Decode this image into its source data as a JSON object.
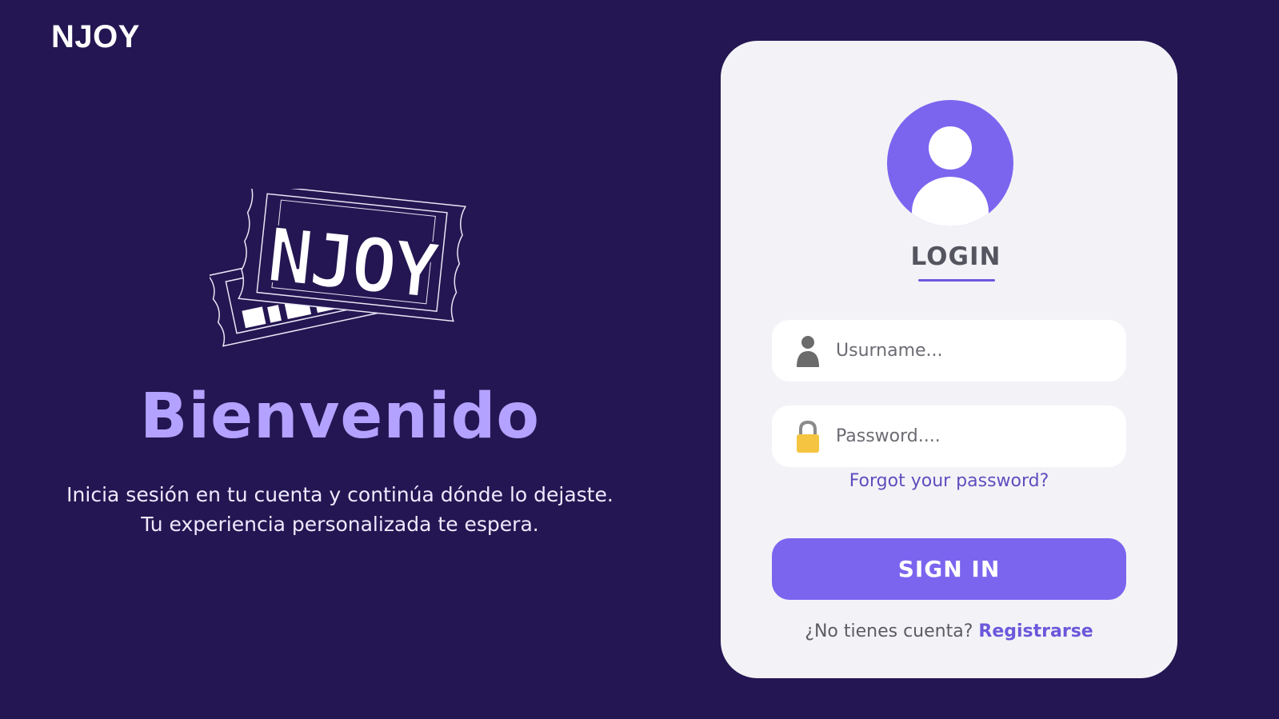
{
  "header": {
    "brand": "NJOY"
  },
  "hero": {
    "logo_text": "NJOY",
    "title": "Bienvenido",
    "subtitle_line1": "Inicia sesión en tu cuenta y continúa dónde lo dejaste.",
    "subtitle_line2": "Tu experiencia personalizada te espera."
  },
  "login": {
    "title": "LOGIN",
    "avatar_icon": "user-avatar-icon",
    "username": {
      "placeholder": "Usurname...",
      "value": "",
      "icon": "user-icon"
    },
    "password": {
      "placeholder": "Password....",
      "value": "",
      "icon": "lock-icon"
    },
    "forgot_label": "Forgot your password?",
    "signin_label": "SIGN IN",
    "register_prompt": "¿No tienes cuenta?",
    "register_label": "Registrarse"
  },
  "colors": {
    "background": "#241652",
    "accent": "#7b65ef",
    "accent_light": "#b3a2ff",
    "card": "#f3f3f7",
    "lock": "#f5c542"
  }
}
